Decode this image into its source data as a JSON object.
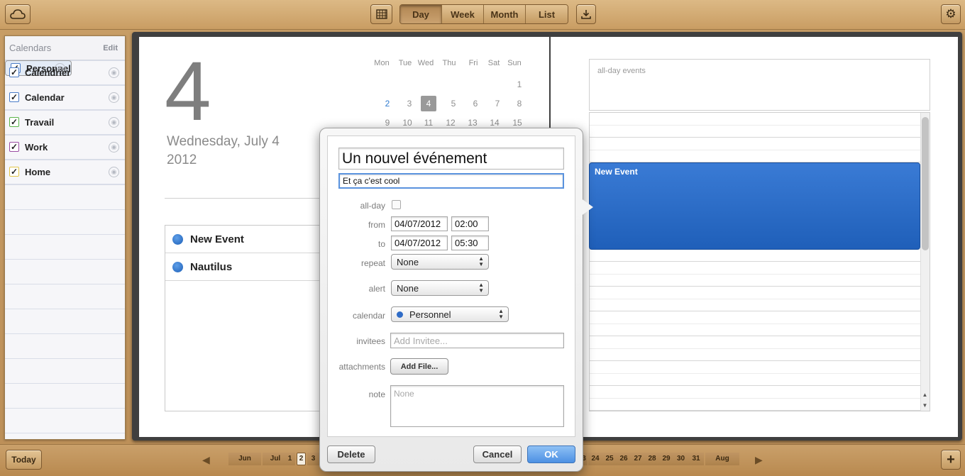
{
  "toolbar": {
    "views": [
      "Day",
      "Week",
      "Month",
      "List"
    ],
    "active_view": "Day"
  },
  "sidebar": {
    "title": "Calendars",
    "edit": "Edit",
    "items": [
      {
        "label": "Personnel",
        "color": "#4a7cc7",
        "selected": true
      },
      {
        "label": "Calendrier",
        "color": "#4a7cc7"
      },
      {
        "label": "Calendar",
        "color": "#4a7cc7"
      },
      {
        "label": "Travail",
        "color": "#5bb54a"
      },
      {
        "label": "Work",
        "color": "#9b4da3"
      },
      {
        "label": "Home",
        "color": "#e2c64a"
      }
    ]
  },
  "day": {
    "number": "4",
    "weekday_line": "Wednesday, July 4",
    "year": "2012"
  },
  "mini_calendar": {
    "headers": [
      "Mon",
      "Tue",
      "Wed",
      "Thu",
      "Fri",
      "Sat",
      "Sun"
    ],
    "row1": [
      "",
      "",
      "",
      "",
      "",
      "",
      "1"
    ],
    "row2": [
      "2",
      "3",
      "4",
      "5",
      "6",
      "7",
      "8"
    ],
    "row3": [
      "9",
      "10",
      "11",
      "12",
      "13",
      "14",
      "15"
    ]
  },
  "event_list": [
    "New Event",
    "Nautilus"
  ],
  "right_page": {
    "allday_label": "all-day events",
    "event_title": "New Event"
  },
  "popover": {
    "title_value": "Un nouvel événement",
    "location_value": "Et ça c'est cool",
    "labels": {
      "allday": "all-day",
      "from": "from",
      "to": "to",
      "repeat": "repeat",
      "alert": "alert",
      "calendar": "calendar",
      "invitees": "invitees",
      "attachments": "attachments",
      "note": "note"
    },
    "from_date": "04/07/2012",
    "from_time": "02:00",
    "to_date": "04/07/2012",
    "to_time": "05:30",
    "repeat_value": "None",
    "alert_value": "None",
    "calendar_value": "Personnel",
    "invitee_placeholder": "Add Invitee...",
    "add_file": "Add File...",
    "note_placeholder": "None",
    "delete": "Delete",
    "cancel": "Cancel",
    "ok": "OK"
  },
  "bottom": {
    "today": "Today",
    "timeline_left": [
      "Jun",
      "Jul",
      "1",
      "2",
      "3"
    ],
    "timeline_right": [
      "3",
      "24",
      "25",
      "26",
      "27",
      "28",
      "29",
      "30",
      "31",
      "Aug"
    ]
  },
  "colors": {
    "event_blue": "#2a6bc9",
    "leather": "#c9a26e"
  }
}
